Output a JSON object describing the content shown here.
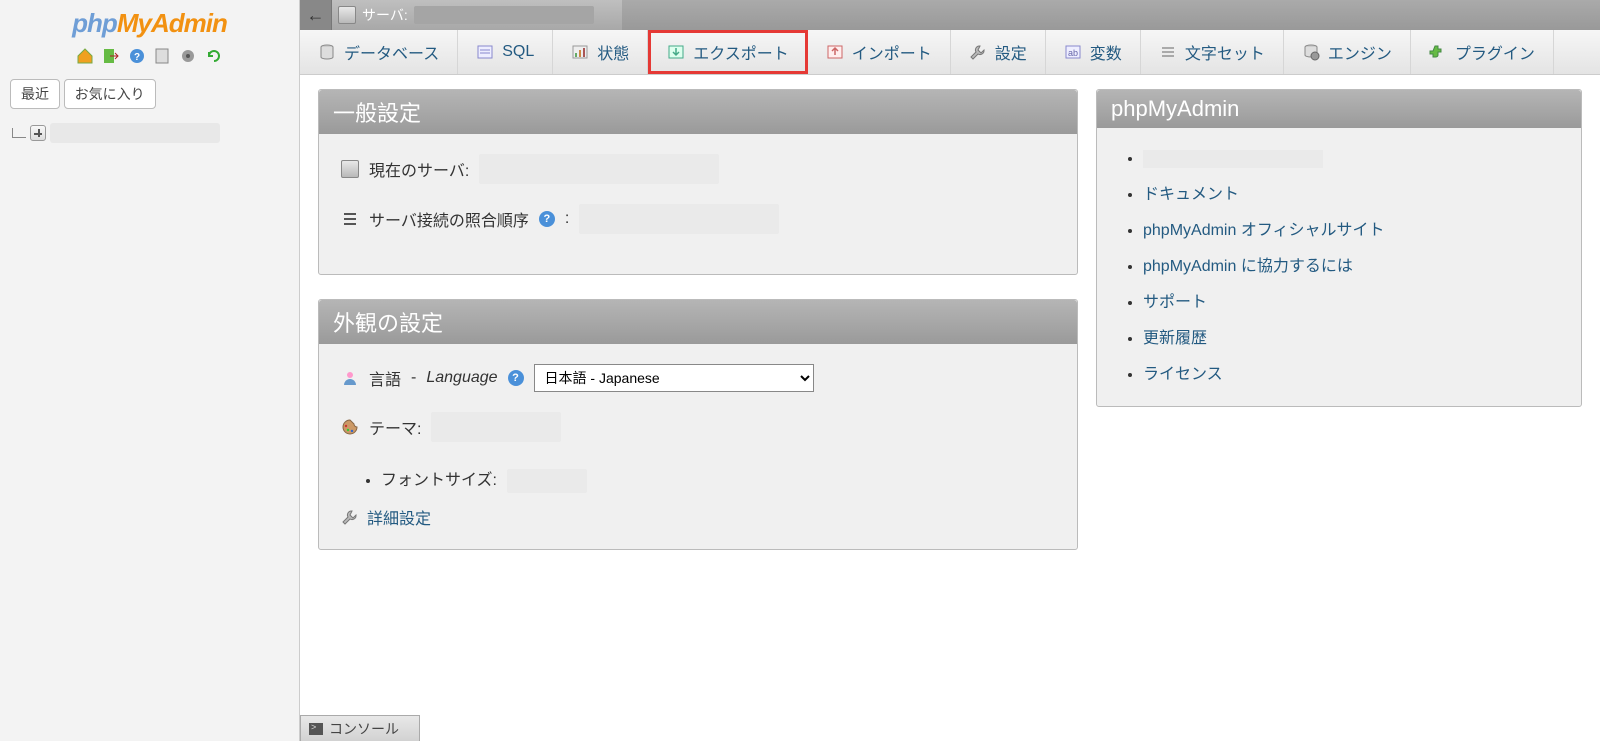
{
  "logo": {
    "part1": "php",
    "part2": "MyAdmin"
  },
  "sidebar": {
    "recent_label": "最近",
    "favorites_label": "お気に入り"
  },
  "serverbar": {
    "back": "←",
    "server_label": "サーバ:"
  },
  "tabs": [
    {
      "id": "databases",
      "label": "データベース"
    },
    {
      "id": "sql",
      "label": "SQL"
    },
    {
      "id": "status",
      "label": "状態"
    },
    {
      "id": "export",
      "label": "エクスポート",
      "highlight": true
    },
    {
      "id": "import",
      "label": "インポート"
    },
    {
      "id": "settings",
      "label": "設定"
    },
    {
      "id": "variables",
      "label": "変数"
    },
    {
      "id": "charsets",
      "label": "文字セット"
    },
    {
      "id": "engines",
      "label": "エンジン"
    },
    {
      "id": "plugins",
      "label": "プラグイン"
    }
  ],
  "general_settings": {
    "title": "一般設定",
    "current_server_label": "現在のサーバ:",
    "collation_label": "サーバ接続の照合順序",
    "collation_suffix": ":"
  },
  "appearance_settings": {
    "title": "外観の設定",
    "language_label_jp": "言語",
    "language_sep": " - ",
    "language_label_en": "Language",
    "language_value": "日本語 - Japanese",
    "theme_label": "テーマ:",
    "fontsize_label": "フォントサイズ:",
    "more_label": "詳細設定"
  },
  "right_panel": {
    "title": "phpMyAdmin",
    "links": [
      {
        "redacted": true
      },
      {
        "label": "ドキュメント"
      },
      {
        "label": "phpMyAdmin オフィシャルサイト"
      },
      {
        "label": "phpMyAdmin に協力するには"
      },
      {
        "label": "サポート"
      },
      {
        "label": "更新履歴"
      },
      {
        "label": "ライセンス"
      }
    ]
  },
  "console": {
    "label": "コンソール"
  }
}
